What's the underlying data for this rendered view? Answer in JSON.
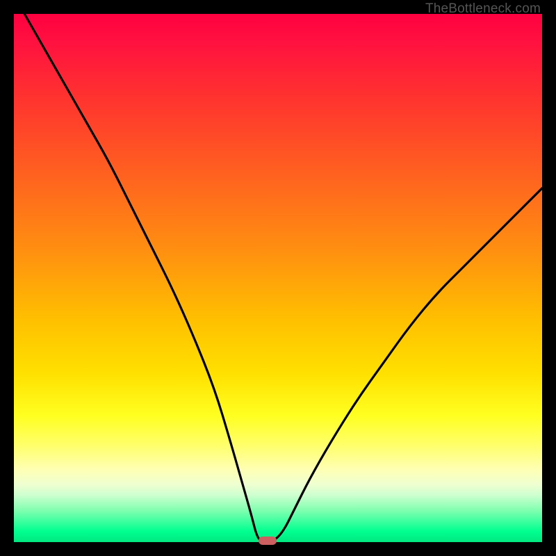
{
  "watermark": "TheBottleneck.com",
  "chart_data": {
    "type": "line",
    "title": "",
    "xlabel": "",
    "ylabel": "",
    "xlim": [
      0,
      100
    ],
    "ylim": [
      0,
      100
    ],
    "series": [
      {
        "name": "bottleneck-curve",
        "x": [
          2,
          6,
          10,
          14,
          18,
          22,
          26,
          30,
          34,
          38,
          41,
          43,
          45,
          46,
          47,
          49,
          51,
          53,
          56,
          60,
          65,
          70,
          75,
          80,
          85,
          90,
          95,
          100
        ],
        "values": [
          100,
          93,
          86,
          79,
          72,
          64,
          56,
          48,
          39,
          29,
          19,
          12,
          5,
          1,
          0,
          0,
          2,
          6,
          12,
          19,
          27,
          34,
          41,
          47,
          52,
          57,
          62,
          67
        ]
      }
    ],
    "marker": {
      "x": 48,
      "y": 0,
      "color": "#cc6060"
    },
    "background_gradient": {
      "top": "#ff0040",
      "middle": "#ffff20",
      "bottom": "#00e880"
    }
  }
}
